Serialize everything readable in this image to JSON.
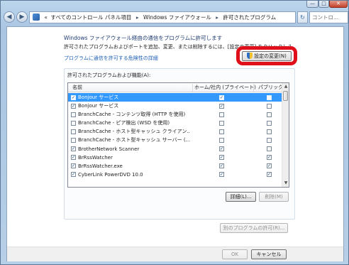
{
  "window": {
    "minimize_glyph": "—",
    "maximize_glyph": "□",
    "close_glyph": "✕"
  },
  "navigation": {
    "back_icon": "back-arrow-icon",
    "forward_icon": "forward-arrow-icon",
    "breadcrumb": [
      "«",
      "すべてのコントロール パネル項目",
      "Windows ファイアウォール",
      "許可されたプログラム"
    ],
    "separator": "▸",
    "refresh_glyph": "↻",
    "search_placeholder": "コントロ..."
  },
  "page": {
    "title": "Windows ファイアウォール経由の通信をプログラムに許可します",
    "instruction": "許可されたプログラムおよびポートを追加、変更、または削除するには、[設定の変更] をクリックします",
    "risk_link": "プログラムに通信を許可する危険性の詳細",
    "change_settings_button": "設定の変更(N)",
    "change_settings_icon": "uac-shield-icon",
    "highlight_color": "#e0101a"
  },
  "programs": {
    "group_label": "許可されたプログラムおよび機能(A):",
    "columns": [
      "名前",
      "ホーム/社内 (プライベート)",
      "パブリック"
    ],
    "rows": [
      {
        "name": "Bonjour サービス",
        "enabled": true,
        "private": true,
        "public": false,
        "selected": true
      },
      {
        "name": "Bonjour サービス",
        "enabled": true,
        "private": true,
        "public": false,
        "selected": false
      },
      {
        "name": "BranchCache - コンテンツ取得 (HTTP を使用)",
        "enabled": false,
        "private": false,
        "public": false,
        "selected": false
      },
      {
        "name": "BranchCache - ピア検出 (WSD を使用)",
        "enabled": false,
        "private": false,
        "public": false,
        "selected": false
      },
      {
        "name": "BranchCache - ホスト型キャッシュ クライアン...",
        "enabled": false,
        "private": false,
        "public": false,
        "selected": false
      },
      {
        "name": "BranchCache - ホスト型キャッシュ サーバー (...",
        "enabled": false,
        "private": false,
        "public": false,
        "selected": false
      },
      {
        "name": "BrotherNetwork Scanner",
        "enabled": true,
        "private": true,
        "public": false,
        "selected": false
      },
      {
        "name": "BrRssWatcher",
        "enabled": true,
        "private": true,
        "public": true,
        "selected": false
      },
      {
        "name": "BrRssWatcher.exe",
        "enabled": true,
        "private": true,
        "public": true,
        "selected": false
      },
      {
        "name": "CyberLink PowerDVD 10.0",
        "enabled": true,
        "private": true,
        "public": true,
        "selected": false
      }
    ],
    "details_button": "詳細(L)...",
    "remove_button": "削除(M)",
    "allow_other_button": "別のプログラムの許可(R)...",
    "check_glyph": "✓"
  },
  "footer": {
    "ok_button": "OK",
    "cancel_button": "キャンセル"
  }
}
